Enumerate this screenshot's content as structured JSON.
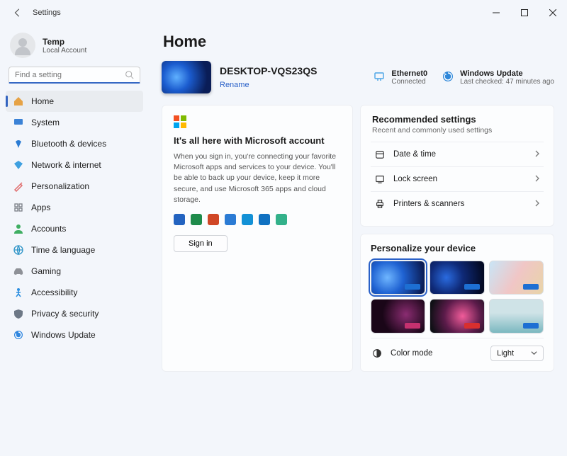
{
  "window": {
    "title": "Settings"
  },
  "user": {
    "name": "Temp",
    "type": "Local Account"
  },
  "search": {
    "placeholder": "Find a setting"
  },
  "sidebar": {
    "items": [
      {
        "label": "Home",
        "icon_color": "#e6a245"
      },
      {
        "label": "System",
        "icon_color": "#3b82d6"
      },
      {
        "label": "Bluetooth & devices",
        "icon_color": "#2a7bd3"
      },
      {
        "label": "Network & internet",
        "icon_color": "#3ea0e0"
      },
      {
        "label": "Personalization",
        "icon_color": "#e06c6c"
      },
      {
        "label": "Apps",
        "icon_color": "#7a7e86"
      },
      {
        "label": "Accounts",
        "icon_color": "#3fae62"
      },
      {
        "label": "Time & language",
        "icon_color": "#2b93c7"
      },
      {
        "label": "Gaming",
        "icon_color": "#8e9197"
      },
      {
        "label": "Accessibility",
        "icon_color": "#2d8fe0"
      },
      {
        "label": "Privacy & security",
        "icon_color": "#6d7886"
      },
      {
        "label": "Windows Update",
        "icon_color": "#2f86df"
      }
    ],
    "selected_index": 0
  },
  "page": {
    "heading": "Home",
    "device_name": "DESKTOP-VQS23QS",
    "rename_label": "Rename",
    "network": {
      "title": "Ethernet0",
      "subtitle": "Connected"
    },
    "update": {
      "title": "Windows Update",
      "subtitle": "Last checked: 47 minutes ago"
    },
    "ms_card": {
      "title": "It's all here with Microsoft account",
      "body": "When you sign in, you're connecting your favorite Microsoft apps and services to your device. You'll be able to back up your device, keep it more secure, and use Microsoft 365 apps and cloud storage.",
      "sign_in_label": "Sign in"
    },
    "recommended": {
      "title": "Recommended settings",
      "subtitle": "Recent and commonly used settings",
      "items": [
        {
          "label": "Date & time"
        },
        {
          "label": "Lock screen"
        },
        {
          "label": "Printers & scanners"
        }
      ]
    },
    "personalize": {
      "title": "Personalize your device",
      "color_mode_label": "Color mode",
      "color_mode_value": "Light"
    }
  }
}
